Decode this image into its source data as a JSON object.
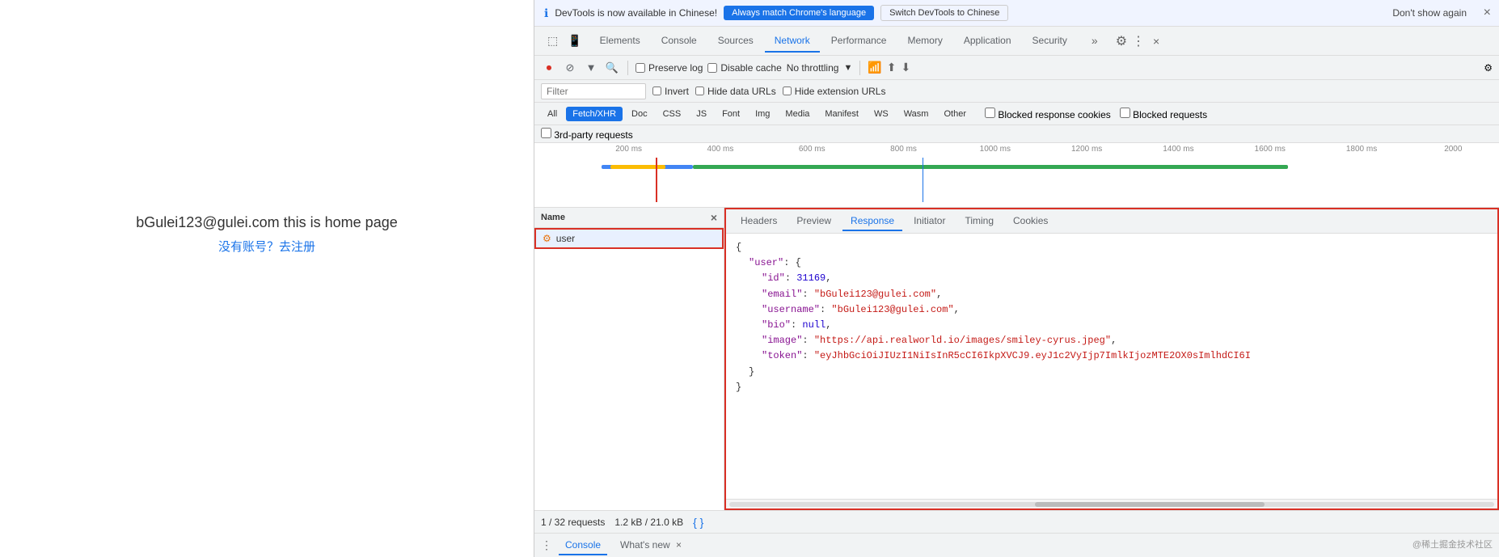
{
  "page": {
    "title": "bGulei123@gulei.com this is home page",
    "link": "没有账号？去注册"
  },
  "infobar": {
    "text": "DevTools is now available in Chinese!",
    "btn1": "Always match Chrome's language",
    "btn2": "Switch DevTools to Chinese",
    "dont_show": "Don't show again",
    "close": "×"
  },
  "tabs": {
    "items": [
      "Elements",
      "Console",
      "Sources",
      "Network",
      "Performance",
      "Memory",
      "Application",
      "Security",
      "»"
    ],
    "active": "Network",
    "devtools_icon1": "⠿",
    "devtools_icon2": "⬜"
  },
  "toolbar": {
    "items": [
      "⏺",
      "⊘",
      "▼",
      "🔍"
    ],
    "preserve_log": "Preserve log",
    "disable_cache": "Disable cache",
    "throttling": "No throttling",
    "icons_right": [
      "⇅",
      "⬆",
      "⬇"
    ]
  },
  "filter": {
    "placeholder": "Filter",
    "invert": "Invert",
    "hide_data": "Hide data URLs",
    "hide_ext": "Hide extension URLs"
  },
  "type_filters": {
    "buttons": [
      "All",
      "Fetch/XHR",
      "Doc",
      "CSS",
      "JS",
      "Font",
      "Img",
      "Media",
      "Manifest",
      "WS",
      "Wasm",
      "Other"
    ],
    "active": "Fetch/XHR",
    "blocked_cookies": "Blocked response cookies",
    "blocked_requests": "Blocked requests",
    "third_party": "3rd-party requests"
  },
  "timeline": {
    "labels": [
      "200 ms",
      "400 ms",
      "600 ms",
      "800 ms",
      "1000 ms",
      "1200 ms",
      "1400 ms",
      "1600 ms",
      "1800 ms",
      "2000"
    ]
  },
  "request_list": {
    "header": "Name",
    "items": [
      {
        "icon": "⚙",
        "name": "user",
        "selected": true
      }
    ]
  },
  "response_panel": {
    "tabs": [
      "Headers",
      "Preview",
      "Response",
      "Initiator",
      "Timing",
      "Cookies"
    ],
    "active_tab": "Response",
    "json": {
      "lines": [
        {
          "type": "brace",
          "text": "{"
        },
        {
          "type": "key",
          "text": "\"user\": {"
        },
        {
          "type": "entry",
          "key": "\"id\"",
          "value": "31169,"
        },
        {
          "type": "entry",
          "key": "\"email\"",
          "value": "\"bGulei123@gulei.com\","
        },
        {
          "type": "entry",
          "key": "\"username\"",
          "value": "\"bGulei123@gulei.com\","
        },
        {
          "type": "entry",
          "key": "\"bio\"",
          "value": "null,"
        },
        {
          "type": "entry",
          "key": "\"image\"",
          "value": "\"https://api.realworld.io/images/smiley-cyrus.jpeg\","
        },
        {
          "type": "entry",
          "key": "\"token\"",
          "value": "\"eyJhbGciOiJIUzI1NiIsInR5cCI6IkpXVCJ9.eyJ1c2VyIjp7ImlkIjozMTE2OX0sImlhdCI6I"
        },
        {
          "type": "close_inner",
          "text": "}"
        },
        {
          "type": "close_outer",
          "text": "}"
        }
      ]
    }
  },
  "status_bar": {
    "requests": "1 / 32 requests",
    "size": "1.2 kB / 21.0 kB",
    "json_btn": "{ }"
  },
  "console_bar": {
    "menu_icon": "⋮",
    "tab": "Console",
    "whats_new": "What's new",
    "close": "×"
  },
  "watermark": "@稀土掘金技术社区"
}
